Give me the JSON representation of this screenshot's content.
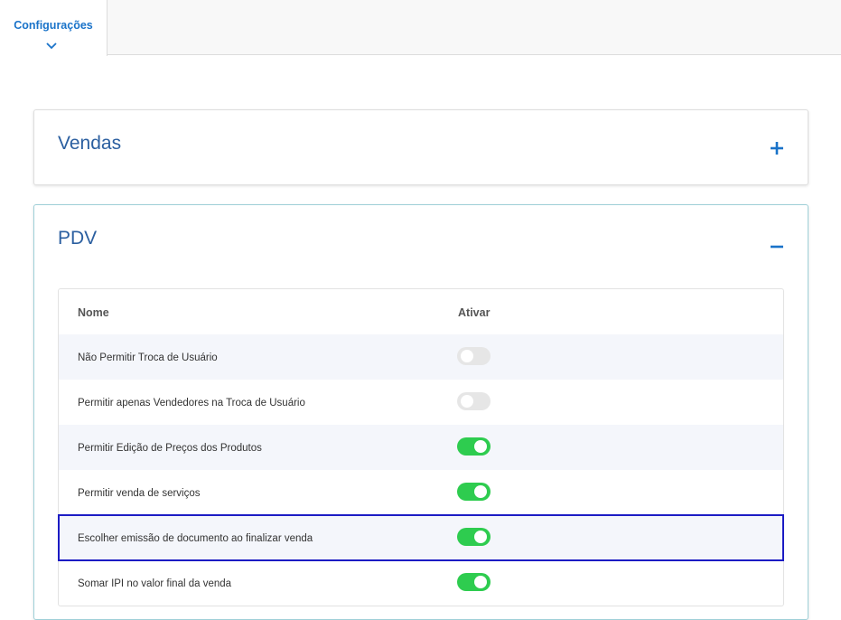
{
  "header": {
    "tabs": [
      {
        "label": "Configurações",
        "active": true
      }
    ]
  },
  "panels": {
    "vendas": {
      "title": "Vendas",
      "expanded": false
    },
    "pdv": {
      "title": "PDV",
      "expanded": true,
      "table": {
        "columns": {
          "name": "Nome",
          "active": "Ativar"
        },
        "rows": [
          {
            "name": "Não Permitir Troca de Usuário",
            "active": false
          },
          {
            "name": "Permitir apenas Vendedores na Troca de Usuário",
            "active": false
          },
          {
            "name": "Permitir Edição de Preços dos Produtos",
            "active": true
          },
          {
            "name": "Permitir venda de serviços",
            "active": true
          },
          {
            "name": "Escolher emissão de documento ao finalizar venda",
            "active": true,
            "selected": true
          },
          {
            "name": "Somar IPI no valor final da venda",
            "active": true
          }
        ]
      }
    }
  },
  "colors": {
    "accent": "#1a73c9",
    "title": "#2b5fa0",
    "switch_on": "#2ecc4f",
    "switch_off": "#e6e6e6",
    "selection": "#1c1cc4"
  },
  "icons": {
    "tab_indicator": "chevron-down-icon",
    "expand": "plus-icon",
    "collapse": "minus-icon"
  }
}
